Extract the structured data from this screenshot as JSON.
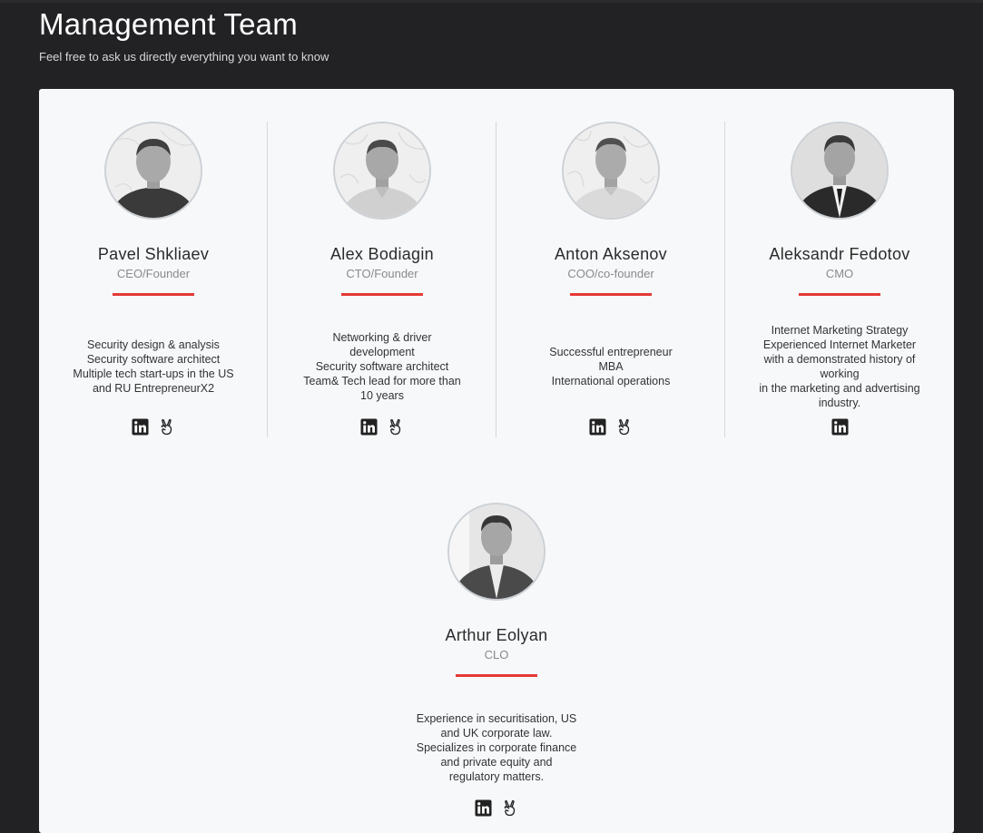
{
  "header": {
    "title": "Management Team",
    "subtitle": "Feel free to ask us directly everything you want to know"
  },
  "colors": {
    "page_background": "#222124",
    "card_background": "#f6f8fa",
    "accent": "#e53935"
  },
  "team": [
    {
      "name": "Pavel Shkliaev",
      "role": "CEO/Founder",
      "bio": [
        "Security design & analysis",
        "Security software architect",
        "Multiple tech start-ups in the US",
        "and RU EntrepreneurX2"
      ],
      "social": [
        "linkedin-icon",
        "angellist-icon"
      ]
    },
    {
      "name": "Alex Bodiagin",
      "role": "CTO/Founder",
      "bio": [
        "Networking & driver",
        "development",
        "Security software architect",
        "Team& Tech lead for more than",
        "10 years"
      ],
      "social": [
        "linkedin-icon",
        "angellist-icon"
      ]
    },
    {
      "name": "Anton Aksenov",
      "role": "COO/co-founder",
      "bio": [
        "Successful entrepreneur",
        "MBA",
        "International operations"
      ],
      "social": [
        "linkedin-icon",
        "angellist-icon"
      ]
    },
    {
      "name": "Aleksandr Fedotov",
      "role": "CMO",
      "bio": [
        "Internet Marketing Strategy",
        "Experienced Internet Marketer",
        "with a demonstrated history of",
        "working",
        "in the marketing and advertising",
        "industry."
      ],
      "social": [
        "linkedin-icon"
      ]
    },
    {
      "name": "Arthur Eolyan",
      "role": "CLO",
      "bio": [
        "Experience in securitisation, US",
        "and UK corporate law.",
        "Specializes in corporate finance",
        "and private equity and",
        "regulatory matters."
      ],
      "social": [
        "linkedin-icon",
        "angellist-icon"
      ]
    }
  ]
}
